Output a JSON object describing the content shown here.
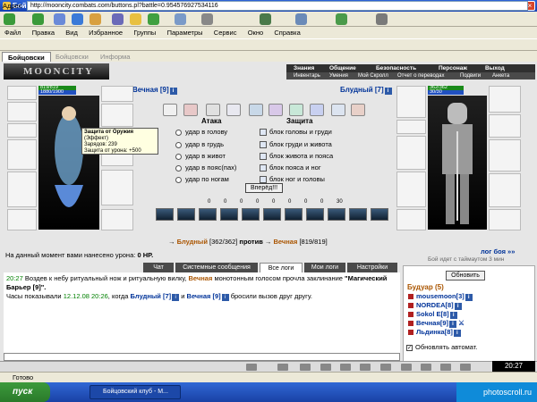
{
  "window": {
    "title": "Бойцовский клуб - MyIE2",
    "min": "_",
    "max": "□",
    "close": "×"
  },
  "menu": [
    "Файл",
    "Правка",
    "Вид",
    "Избранное",
    "Группы",
    "Параметры",
    "Сервис",
    "Окно",
    "Справка"
  ],
  "address": {
    "label": "Адрес",
    "url": "http://mooncity.combats.com/buttons.pl?battle=0.954576927534116"
  },
  "tabs": [
    "Бойцовски",
    "Бойцовски",
    "Информа"
  ],
  "game": {
    "logo": "MOONCITY",
    "top_menu": [
      "Знания",
      "Общение",
      "Безопасность",
      "Персонаж",
      "Выход"
    ],
    "sub_menu": [
      "Инвентарь",
      "Умения",
      "Мой Скролл",
      "Отчет о переводах",
      "Подвиги",
      "Анкета"
    ],
    "left_player": {
      "name": "Вечная [9]",
      "hp": "819/819",
      "mana": "1880/1900"
    },
    "right_player": {
      "name": "Блудный [7]",
      "hp": "362/362",
      "mana": "30/30"
    },
    "tooltip": {
      "title": "Защита от Оружия",
      "kind": "(Эффект)",
      "line1": "Зарядов: 239",
      "line2": "Защита от урона: +500"
    },
    "attack_header": "Атака",
    "defense_header": "Защита",
    "attack_options": [
      "удар в голову",
      "удар в грудь",
      "удар в живот",
      "удар в пояс(пах)",
      "удар по ногам"
    ],
    "defense_options": [
      "блок головы и груди",
      "блок груди и живота",
      "блок живота и пояса",
      "блок пояса и ног",
      "блок ног и головы"
    ],
    "forward_button": "Вперёд!!!",
    "stats": [
      "0",
      "0",
      "0",
      "0",
      "0",
      "0",
      "0",
      "0",
      "30"
    ],
    "versus": {
      "left": "Блудный",
      "left_hp": "[362/362]",
      "word": "против",
      "right": "Вечная",
      "right_hp": "[819/819]"
    },
    "damage_text": "На данный момент вами нанесено урона:",
    "damage_value": "0 HP.",
    "log_link": "лог боя »»",
    "wait_text": "Бой идет с таймаутом 3 мин"
  },
  "chat": {
    "tabs": [
      "Чат",
      "Системные сообщения",
      "Все логи",
      "Мои логи",
      "Настройки"
    ],
    "active_tab": "Все логи",
    "line1_time": "20:27",
    "line1_a": "Воздев к небу ритуальный нож и ритуальную вилку,",
    "line1_name": "Вечная",
    "line1_b": "монотонным голосом прочла заклинание",
    "line1_spell": "\"Магический Барьер [9]\".",
    "line2_a": "Часы показывали",
    "line2_time": "12.12.08 20:26",
    "line2_b": ", когда",
    "line2_name1": "Блудный [7]",
    "line2_and": "и",
    "line2_name2": "Вечная [9]",
    "line2_c": "бросили вызов друг другу."
  },
  "room": {
    "refresh_button": "Обновить",
    "title": "Будуар (5)",
    "players": [
      "mousemoon[3]",
      "NORDEA[8]",
      "Sokol E[8]",
      "Вечная[9]",
      "Льдинка[8]"
    ],
    "auto_refresh": "Обновлять автомат."
  },
  "clock": "20:27",
  "status": "Готово",
  "taskbar": {
    "start": "пуск",
    "task": "Бойцовский клуб - M...",
    "tray": "photoscroll.ru"
  }
}
